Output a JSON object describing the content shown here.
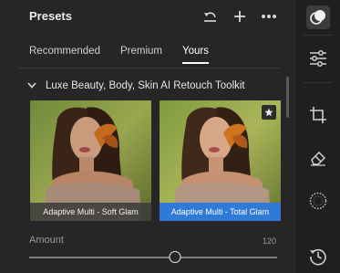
{
  "header": {
    "title": "Presets"
  },
  "tabs": [
    {
      "label": "Recommended"
    },
    {
      "label": "Premium"
    },
    {
      "label": "Yours"
    }
  ],
  "group": {
    "title": "Luxe Beauty, Body, Skin AI Retouch Toolkit"
  },
  "presets": [
    {
      "label": "Adaptive Multi - Soft Glam",
      "selected": false
    },
    {
      "label": "Adaptive Multi - Total Glam",
      "selected": true
    }
  ],
  "amount": {
    "label": "Amount",
    "value": "120",
    "fraction": 0.59
  },
  "colors": {
    "accent": "#2f7ad6"
  },
  "icons": [
    "undo-icon",
    "plus-icon",
    "more-icon",
    "presets-icon",
    "sliders-icon",
    "crop-icon",
    "eraser-icon",
    "masking-icon",
    "history-icon",
    "chevron-down-icon",
    "star-icon"
  ]
}
